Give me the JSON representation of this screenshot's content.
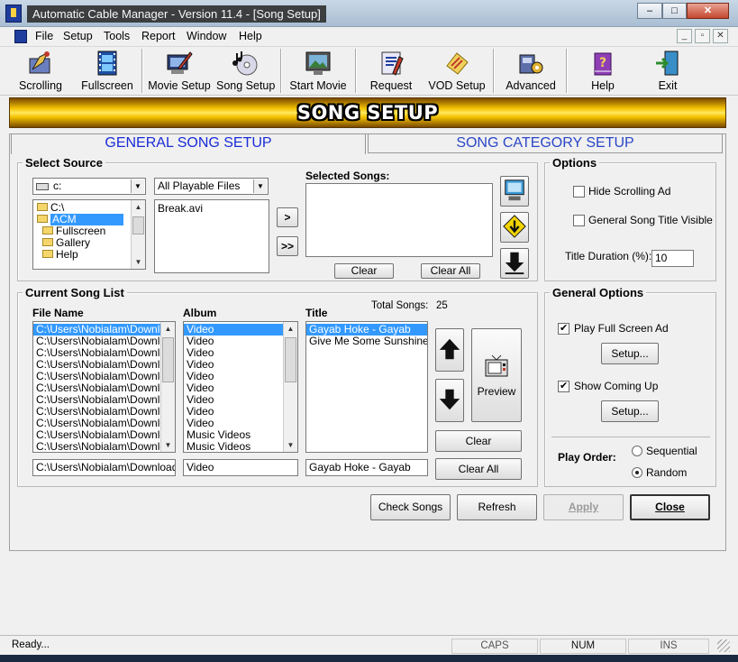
{
  "window": {
    "title": "Automatic Cable Manager - Version 11.4 - [Song Setup]",
    "minimize": "–",
    "maximize": "□",
    "close": "✕"
  },
  "menu": [
    "File",
    "Setup",
    "Tools",
    "Report",
    "Window",
    "Help"
  ],
  "mdi_controls": [
    "_",
    "▫",
    "✕"
  ],
  "toolbar": [
    {
      "label": "Scrolling",
      "icon": "scrolling-icon"
    },
    {
      "label": "Fullscreen",
      "icon": "film-icon"
    },
    {
      "label": "Movie Setup",
      "icon": "movie-setup-icon"
    },
    {
      "label": "Song Setup",
      "icon": "cd-icon"
    },
    {
      "label": "Start Movie",
      "icon": "monitor-icon"
    },
    {
      "label": "Request",
      "icon": "request-icon"
    },
    {
      "label": "VOD Setup",
      "icon": "vod-icon"
    },
    {
      "label": "Advanced",
      "icon": "advanced-icon"
    },
    {
      "label": "Help",
      "icon": "help-book-icon"
    },
    {
      "label": "Exit",
      "icon": "exit-door-icon"
    }
  ],
  "banner": "SONG SETUP",
  "tabs": {
    "general": "GENERAL SONG SETUP",
    "category": "SONG CATEGORY SETUP"
  },
  "select_source": {
    "title": "Select Source",
    "drive": "c:",
    "filter": "All Playable Files",
    "folders": [
      "C:\\",
      "ACM",
      "Fullscreen",
      "Gallery",
      "Help"
    ],
    "files": [
      "Break.avi"
    ],
    "add_one": ">",
    "add_all": ">>",
    "selected_label": "Selected Songs:",
    "clear": "Clear",
    "clear_all": "Clear All"
  },
  "options": {
    "title": "Options",
    "hide_scrolling": "Hide Scrolling Ad",
    "title_visible": "General Song Title Visible",
    "duration_label": "Title Duration (%):",
    "duration_value": "10"
  },
  "current_list": {
    "title": "Current Song List",
    "col_file": "File Name",
    "col_album": "Album",
    "col_title": "Title",
    "total_label": "Total Songs:",
    "total_value": "25",
    "files": [
      "C:\\Users\\Nobialam\\Downloa",
      "C:\\Users\\Nobialam\\Downloa",
      "C:\\Users\\Nobialam\\Downloa",
      "C:\\Users\\Nobialam\\Downloa",
      "C:\\Users\\Nobialam\\Downloa",
      "C:\\Users\\Nobialam\\Downloa",
      "C:\\Users\\Nobialam\\Downloa",
      "C:\\Users\\Nobialam\\Downloa",
      "C:\\Users\\Nobialam\\Downloa",
      "C:\\Users\\Nobialam\\Downloa",
      "C:\\Users\\Nobialam\\Downloa"
    ],
    "albums": [
      "Video",
      "Video",
      "Video",
      "Video",
      "Video",
      "Video",
      "Video",
      "Video",
      "Video",
      "Music Videos",
      "Music Videos"
    ],
    "titles": [
      "Gayab Hoke - Gayab",
      "Give Me Some Sunshine [Fu"
    ],
    "file_value": "C:\\Users\\Nobialam\\Downloads\\",
    "album_value": "Video",
    "title_value": "Gayab Hoke - Gayab",
    "preview": "Preview",
    "clear": "Clear",
    "clear_all": "Clear All"
  },
  "general_options": {
    "title": "General Options",
    "play_full_screen": "Play Full Screen Ad",
    "setup1": "Setup...",
    "show_coming_up": "Show Coming Up",
    "setup2": "Setup...",
    "play_order_label": "Play Order:",
    "sequential": "Sequential",
    "random": "Random"
  },
  "actions": {
    "check": "Check Songs",
    "refresh": "Refresh",
    "apply": "Apply",
    "close": "Close"
  },
  "status": {
    "text": "Ready...",
    "caps": "CAPS",
    "num": "NUM",
    "ins": "INS"
  }
}
